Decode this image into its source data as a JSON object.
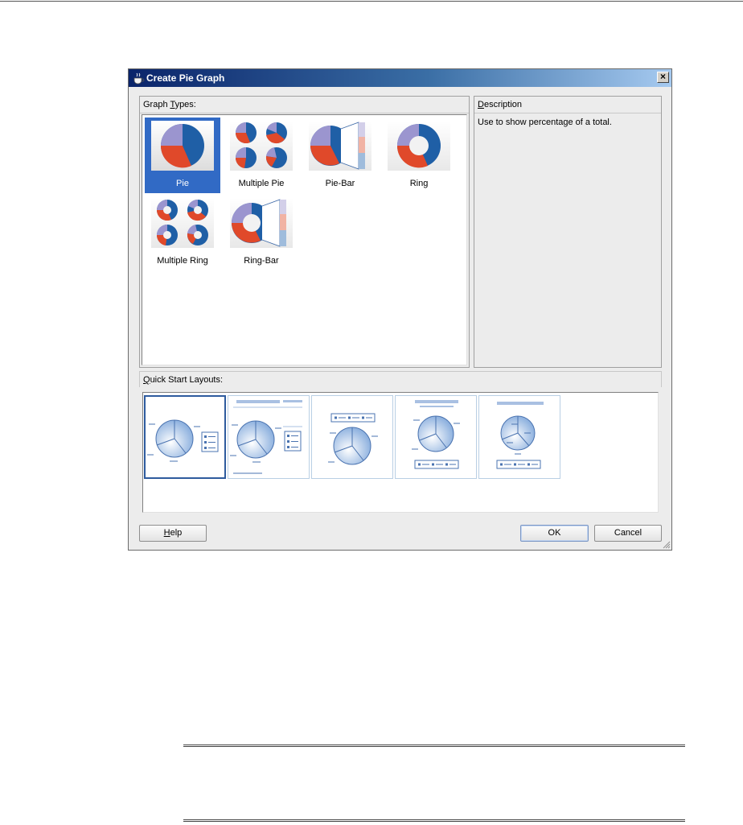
{
  "dialog": {
    "title": "Create Pie Graph",
    "close_symbol": "×"
  },
  "graph_types": {
    "header_prefix": "Graph ",
    "header_mnemonic": "T",
    "header_suffix": "ypes:",
    "items": [
      {
        "label": "Pie",
        "icon": "pie-icon",
        "selected": true
      },
      {
        "label": "Multiple Pie",
        "icon": "multiple-pie-icon",
        "selected": false
      },
      {
        "label": "Pie-Bar",
        "icon": "pie-bar-icon",
        "selected": false
      },
      {
        "label": "Ring",
        "icon": "ring-icon",
        "selected": false
      },
      {
        "label": "Multiple Ring",
        "icon": "multiple-ring-icon",
        "selected": false
      },
      {
        "label": "Ring-Bar",
        "icon": "ring-bar-icon",
        "selected": false
      }
    ]
  },
  "description": {
    "header_mnemonic": "D",
    "header_suffix": "escription",
    "text": "Use to show percentage of a total."
  },
  "quick_start": {
    "header_mnemonic": "Q",
    "header_suffix": "uick Start Layouts:",
    "selected_index": 0,
    "layout_count": 5
  },
  "buttons": {
    "help_mnemonic": "H",
    "help_suffix": "elp",
    "ok": "OK",
    "cancel": "Cancel"
  },
  "colors": {
    "selection": "#316ac5",
    "pie_blue": "#1f5fa6",
    "pie_red": "#e0492a",
    "pie_purple": "#9b95cf",
    "layout_blue": "#8fb2df"
  }
}
